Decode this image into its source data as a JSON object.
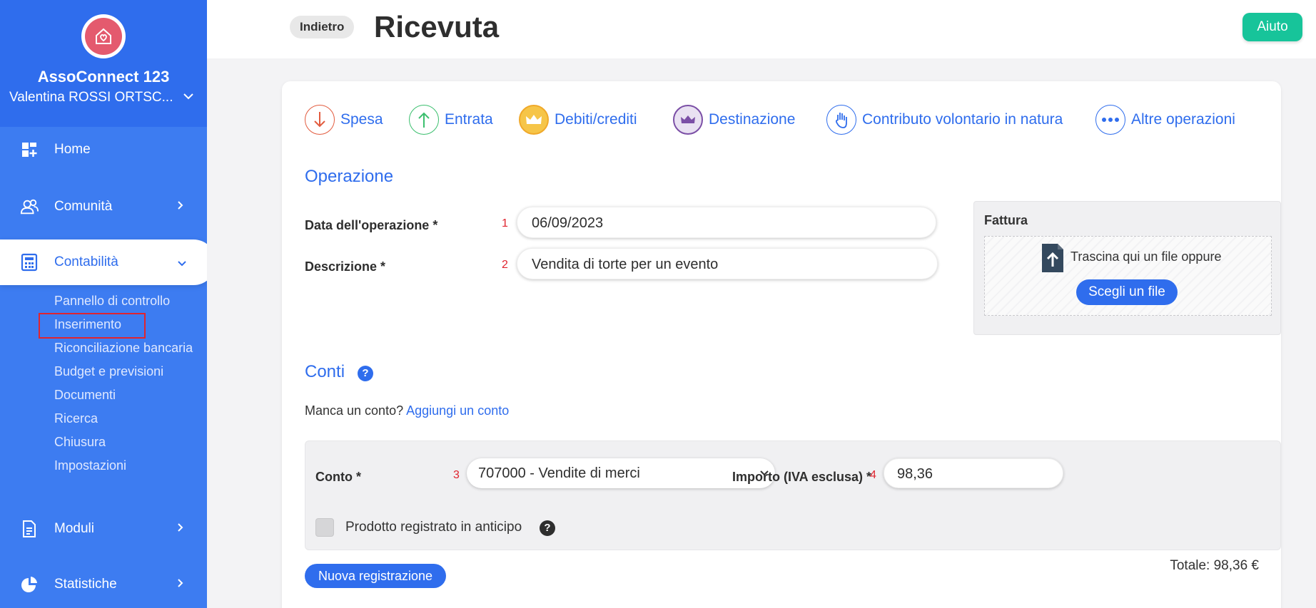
{
  "sidebar": {
    "org_name": "AssoConnect 123",
    "user_name": "Valentina ROSSI ORTSC...",
    "nav": {
      "home": "Home",
      "comunita": "Comunità",
      "contabilita": "Contabilità",
      "moduli": "Moduli",
      "statistiche": "Statistiche"
    },
    "subnav": [
      "Pannello di controllo",
      "Inserimento",
      "Riconciliazione bancaria",
      "Budget e previsioni",
      "Documenti",
      "Ricerca",
      "Chiusura",
      "Impostazioni"
    ]
  },
  "header": {
    "back_label": "Indietro",
    "title": "Ricevuta",
    "help_label": "Aiuto"
  },
  "operations": [
    {
      "label": "Spesa",
      "icon": "arrow-down-icon",
      "color": "#e25b3e"
    },
    {
      "label": "Entrata",
      "icon": "arrow-up-icon",
      "color": "#3bbf6e"
    },
    {
      "label": "Debiti/crediti",
      "icon": "crown-icon",
      "color": "#f2b630"
    },
    {
      "label": "Destinazione",
      "icon": "crown-arrows-icon",
      "color": "#7b4fa6"
    },
    {
      "label": "Contributo volontario in natura",
      "icon": "hand-icon",
      "color": "#2f6ded"
    },
    {
      "label": "Altre operazioni",
      "icon": "more-icon",
      "color": "#2f6ded"
    }
  ],
  "operazione": {
    "section_title": "Operazione",
    "date_label": "Data dell'operazione *",
    "date_marker": "1",
    "date_value": "06/09/2023",
    "desc_label": "Descrizione *",
    "desc_marker": "2",
    "desc_value": "Vendita di torte per un evento"
  },
  "fattura": {
    "title": "Fattura",
    "drop_text": "Trascina qui un file oppure",
    "choose_label": "Scegli un file"
  },
  "conti": {
    "section_title": "Conti",
    "missing_text": "Manca un conto?",
    "add_link": "Aggiungi un conto",
    "conto_label": "Conto *",
    "conto_marker": "3",
    "conto_value": "707000 - Vendite di merci",
    "importo_label": "Importo (IVA esclusa) *",
    "importo_marker": "4",
    "importo_value": "98,36",
    "checkbox_label": "Prodotto registrato in anticipo"
  },
  "footer": {
    "new_label": "Nuova registrazione",
    "total": "Totale: 98,36 €"
  },
  "colors": {
    "primary": "#2f6ded",
    "sidebar": "#3d7cf1",
    "help": "#17c49a",
    "marker": "#e0242f"
  }
}
